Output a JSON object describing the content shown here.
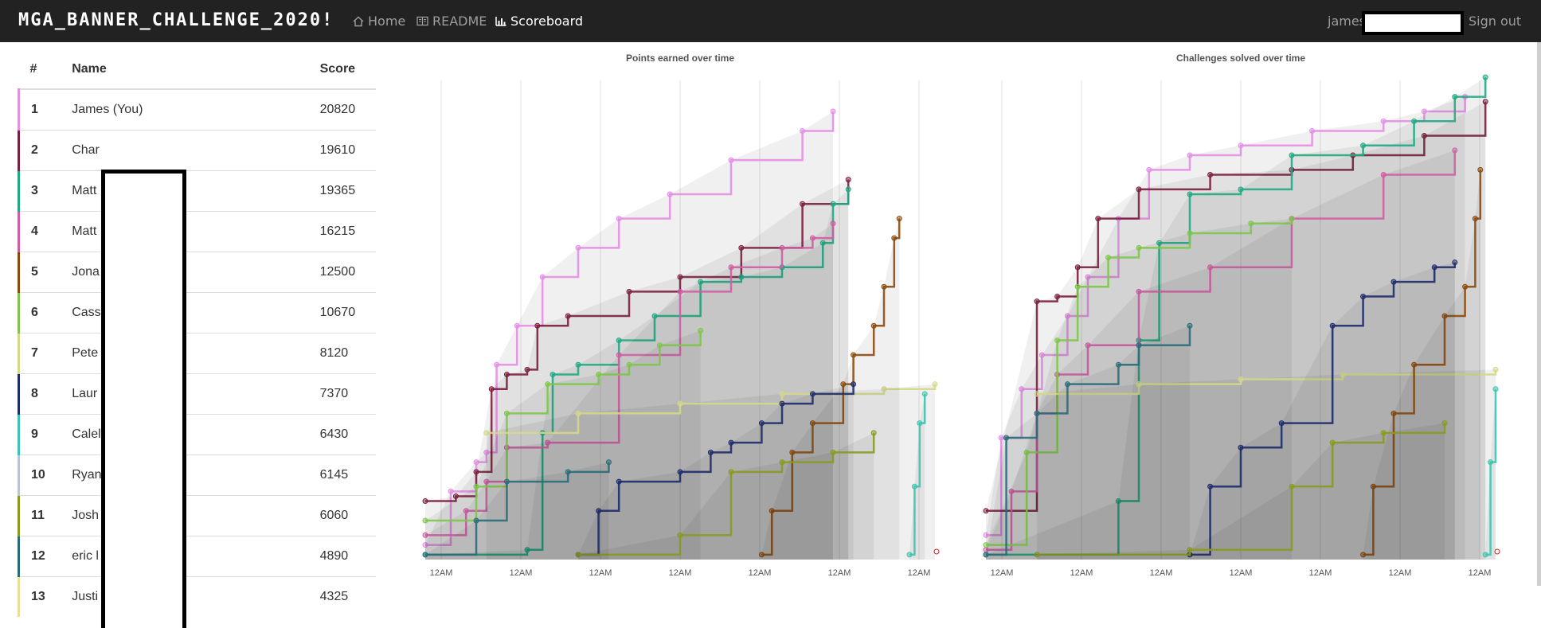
{
  "nav": {
    "brand": "MGA_BANNER_CHALLENGE_2020!",
    "home": "Home",
    "readme": "README",
    "scoreboard": "Scoreboard",
    "user": "james",
    "signout": "Sign out"
  },
  "table": {
    "headers": {
      "rank": "#",
      "name": "Name",
      "score": "Score"
    },
    "rows": [
      {
        "rank": "1",
        "name": "James (You)",
        "score": "20820",
        "color": "#e48ee6"
      },
      {
        "rank": "2",
        "name": "Char",
        "score": "19610",
        "color": "#7a1f3d"
      },
      {
        "rank": "3",
        "name": "Matt",
        "score": "19365",
        "color": "#1faa83"
      },
      {
        "rank": "4",
        "name": "Matt",
        "score": "16215",
        "color": "#cf5da3"
      },
      {
        "rank": "5",
        "name": "Jona",
        "score": "12500",
        "color": "#8a4a0e"
      },
      {
        "rank": "6",
        "name": "Cass",
        "score": "10670",
        "color": "#7dc64a"
      },
      {
        "rank": "7",
        "name": "Pete",
        "score": "8120",
        "color": "#d4d88a"
      },
      {
        "rank": "8",
        "name": "Laur",
        "score": "7370",
        "color": "#1e2b6b"
      },
      {
        "rank": "9",
        "name": "Calel",
        "score": "6430",
        "color": "#3cc4b0"
      },
      {
        "rank": "10",
        "name": "Ryan",
        "score": "6145",
        "color": "#b8c5d4"
      },
      {
        "rank": "11",
        "name": "Josh",
        "score": "6060",
        "color": "#8a9a1e"
      },
      {
        "rank": "12",
        "name": "eric l",
        "score": "4890",
        "color": "#2a6b7a"
      },
      {
        "rank": "13",
        "name": "Justi",
        "score": "4325",
        "color": "#e8e094"
      }
    ]
  },
  "chart_data": [
    {
      "type": "line",
      "title": "Points earned over time",
      "x_ticks": [
        "12AM",
        "12AM",
        "12AM",
        "12AM",
        "12AM",
        "12AM",
        "12AM"
      ],
      "series": [
        {
          "color": "#e48ee6",
          "points": [
            [
              0,
              0.97
            ],
            [
              0.05,
              0.86
            ],
            [
              0.1,
              0.8
            ],
            [
              0.12,
              0.78
            ],
            [
              0.14,
              0.6
            ],
            [
              0.18,
              0.52
            ],
            [
              0.23,
              0.42
            ],
            [
              0.3,
              0.36
            ],
            [
              0.38,
              0.3
            ],
            [
              0.48,
              0.25
            ],
            [
              0.6,
              0.18
            ],
            [
              0.74,
              0.12
            ],
            [
              0.8,
              0.08
            ]
          ]
        },
        {
          "color": "#7a1f3d",
          "points": [
            [
              0,
              0.88
            ],
            [
              0.06,
              0.87
            ],
            [
              0.1,
              0.82
            ],
            [
              0.13,
              0.65
            ],
            [
              0.16,
              0.62
            ],
            [
              0.2,
              0.61
            ],
            [
              0.22,
              0.52
            ],
            [
              0.28,
              0.5
            ],
            [
              0.4,
              0.45
            ],
            [
              0.5,
              0.42
            ],
            [
              0.62,
              0.36
            ],
            [
              0.74,
              0.27
            ],
            [
              0.83,
              0.22
            ]
          ]
        },
        {
          "color": "#1faa83",
          "points": [
            [
              0,
              0.99
            ],
            [
              0.2,
              0.98
            ],
            [
              0.23,
              0.74
            ],
            [
              0.25,
              0.62
            ],
            [
              0.3,
              0.6
            ],
            [
              0.38,
              0.55
            ],
            [
              0.45,
              0.5
            ],
            [
              0.54,
              0.43
            ],
            [
              0.62,
              0.42
            ],
            [
              0.7,
              0.4
            ],
            [
              0.78,
              0.35
            ],
            [
              0.8,
              0.27
            ],
            [
              0.83,
              0.24
            ]
          ]
        },
        {
          "color": "#cf5da3",
          "points": [
            [
              0,
              0.95
            ],
            [
              0.08,
              0.9
            ],
            [
              0.12,
              0.84
            ],
            [
              0.16,
              0.77
            ],
            [
              0.24,
              0.76
            ],
            [
              0.38,
              0.58
            ],
            [
              0.5,
              0.45
            ],
            [
              0.6,
              0.4
            ],
            [
              0.7,
              0.36
            ],
            [
              0.76,
              0.34
            ],
            [
              0.8,
              0.31
            ]
          ]
        },
        {
          "color": "#7dc64a",
          "points": [
            [
              0,
              0.92
            ],
            [
              0.1,
              0.85
            ],
            [
              0.16,
              0.7
            ],
            [
              0.24,
              0.64
            ],
            [
              0.34,
              0.62
            ],
            [
              0.4,
              0.6
            ],
            [
              0.46,
              0.56
            ],
            [
              0.54,
              0.53
            ]
          ]
        },
        {
          "color": "#d4d88a",
          "points": [
            [
              0.12,
              0.74
            ],
            [
              0.3,
              0.7
            ],
            [
              0.5,
              0.68
            ],
            [
              0.7,
              0.66
            ],
            [
              0.9,
              0.65
            ],
            [
              1,
              0.64
            ]
          ]
        },
        {
          "color": "#8a4a0e",
          "points": [
            [
              0.66,
              0.99
            ],
            [
              0.68,
              0.9
            ],
            [
              0.72,
              0.78
            ],
            [
              0.76,
              0.72
            ],
            [
              0.82,
              0.64
            ],
            [
              0.84,
              0.58
            ],
            [
              0.88,
              0.52
            ],
            [
              0.9,
              0.44
            ],
            [
              0.92,
              0.34
            ],
            [
              0.93,
              0.3
            ]
          ]
        },
        {
          "color": "#1e2b6b",
          "points": [
            [
              0.3,
              0.99
            ],
            [
              0.34,
              0.9
            ],
            [
              0.38,
              0.84
            ],
            [
              0.5,
              0.82
            ],
            [
              0.56,
              0.78
            ],
            [
              0.6,
              0.76
            ],
            [
              0.66,
              0.72
            ],
            [
              0.7,
              0.68
            ],
            [
              0.76,
              0.66
            ],
            [
              0.84,
              0.64
            ]
          ]
        },
        {
          "color": "#3cc4b0",
          "points": [
            [
              0.95,
              0.99
            ],
            [
              0.96,
              0.85
            ],
            [
              0.97,
              0.72
            ],
            [
              0.98,
              0.66
            ]
          ]
        },
        {
          "color": "#8a9a1e",
          "points": [
            [
              0.3,
              0.99
            ],
            [
              0.5,
              0.95
            ],
            [
              0.6,
              0.82
            ],
            [
              0.7,
              0.8
            ],
            [
              0.8,
              0.78
            ],
            [
              0.88,
              0.74
            ]
          ]
        },
        {
          "color": "#2a6b7a",
          "points": [
            [
              0,
              0.99
            ],
            [
              0.1,
              0.92
            ],
            [
              0.16,
              0.84
            ],
            [
              0.28,
              0.82
            ],
            [
              0.36,
              0.8
            ]
          ]
        }
      ]
    },
    {
      "type": "line",
      "title": "Challenges solved over time",
      "x_ticks": [
        "12AM",
        "12AM",
        "12AM",
        "12AM",
        "12AM",
        "12AM",
        "12AM"
      ],
      "series": [
        {
          "color": "#e48ee6",
          "points": [
            [
              0,
              0.95
            ],
            [
              0.03,
              0.75
            ],
            [
              0.07,
              0.65
            ],
            [
              0.11,
              0.58
            ],
            [
              0.16,
              0.5
            ],
            [
              0.2,
              0.42
            ],
            [
              0.26,
              0.3
            ],
            [
              0.32,
              0.2
            ],
            [
              0.4,
              0.17
            ],
            [
              0.5,
              0.15
            ],
            [
              0.64,
              0.12
            ],
            [
              0.78,
              0.1
            ],
            [
              0.86,
              0.08
            ],
            [
              0.94,
              0.05
            ]
          ]
        },
        {
          "color": "#7a1f3d",
          "points": [
            [
              0,
              0.9
            ],
            [
              0.1,
              0.47
            ],
            [
              0.14,
              0.46
            ],
            [
              0.18,
              0.4
            ],
            [
              0.22,
              0.3
            ],
            [
              0.3,
              0.24
            ],
            [
              0.44,
              0.21
            ],
            [
              0.6,
              0.2
            ],
            [
              0.72,
              0.17
            ],
            [
              0.86,
              0.13
            ],
            [
              0.98,
              0.06
            ]
          ]
        },
        {
          "color": "#1faa83",
          "points": [
            [
              0,
              0.99
            ],
            [
              0.26,
              0.88
            ],
            [
              0.3,
              0.55
            ],
            [
              0.34,
              0.35
            ],
            [
              0.4,
              0.25
            ],
            [
              0.5,
              0.24
            ],
            [
              0.6,
              0.17
            ],
            [
              0.74,
              0.15
            ],
            [
              0.84,
              0.1
            ],
            [
              0.92,
              0.05
            ],
            [
              0.98,
              0.01
            ]
          ]
        },
        {
          "color": "#cf5da3",
          "points": [
            [
              0,
              0.98
            ],
            [
              0.05,
              0.86
            ],
            [
              0.1,
              0.7
            ],
            [
              0.14,
              0.62
            ],
            [
              0.2,
              0.56
            ],
            [
              0.3,
              0.45
            ],
            [
              0.44,
              0.4
            ],
            [
              0.6,
              0.3
            ],
            [
              0.78,
              0.21
            ],
            [
              0.92,
              0.16
            ]
          ]
        },
        {
          "color": "#7dc64a",
          "points": [
            [
              0,
              0.97
            ],
            [
              0.08,
              0.78
            ],
            [
              0.14,
              0.55
            ],
            [
              0.18,
              0.44
            ],
            [
              0.24,
              0.38
            ],
            [
              0.3,
              0.36
            ],
            [
              0.4,
              0.33
            ],
            [
              0.52,
              0.31
            ],
            [
              0.6,
              0.3
            ]
          ]
        },
        {
          "color": "#d4d88a",
          "points": [
            [
              0.1,
              0.66
            ],
            [
              0.3,
              0.64
            ],
            [
              0.5,
              0.63
            ],
            [
              0.7,
              0.62
            ],
            [
              1,
              0.61
            ]
          ]
        },
        {
          "color": "#8a4a0e",
          "points": [
            [
              0.74,
              0.99
            ],
            [
              0.76,
              0.85
            ],
            [
              0.8,
              0.7
            ],
            [
              0.84,
              0.6
            ],
            [
              0.9,
              0.5
            ],
            [
              0.94,
              0.44
            ],
            [
              0.96,
              0.3
            ],
            [
              0.97,
              0.2
            ]
          ]
        },
        {
          "color": "#1e2b6b",
          "points": [
            [
              0.4,
              0.99
            ],
            [
              0.44,
              0.85
            ],
            [
              0.5,
              0.77
            ],
            [
              0.58,
              0.72
            ],
            [
              0.68,
              0.52
            ],
            [
              0.74,
              0.46
            ],
            [
              0.8,
              0.43
            ],
            [
              0.88,
              0.4
            ],
            [
              0.92,
              0.39
            ]
          ]
        },
        {
          "color": "#3cc4b0",
          "points": [
            [
              0.98,
              0.99
            ],
            [
              0.99,
              0.8
            ],
            [
              1,
              0.65
            ]
          ]
        },
        {
          "color": "#8a9a1e",
          "points": [
            [
              0.1,
              0.99
            ],
            [
              0.4,
              0.98
            ],
            [
              0.6,
              0.85
            ],
            [
              0.68,
              0.76
            ],
            [
              0.78,
              0.74
            ],
            [
              0.9,
              0.72
            ]
          ]
        },
        {
          "color": "#2a6b7a",
          "points": [
            [
              0,
              0.99
            ],
            [
              0.04,
              0.75
            ],
            [
              0.1,
              0.7
            ],
            [
              0.16,
              0.64
            ],
            [
              0.26,
              0.6
            ],
            [
              0.3,
              0.56
            ],
            [
              0.4,
              0.52
            ]
          ]
        }
      ]
    }
  ]
}
